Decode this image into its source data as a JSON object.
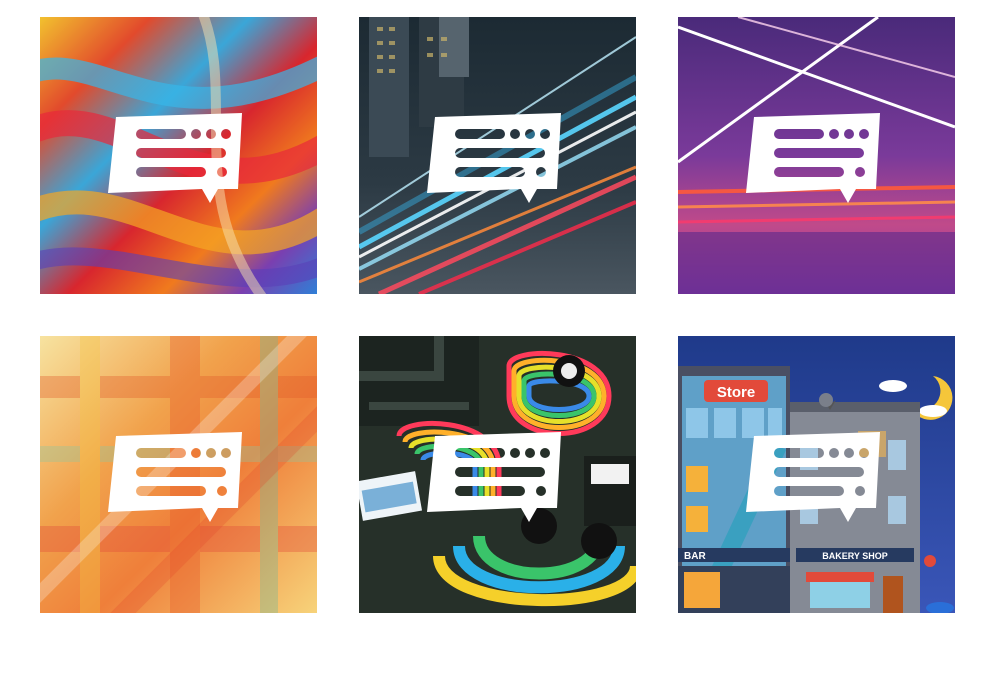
{
  "gallery": {
    "tiles": [
      {
        "theme": "abstract-swirl",
        "accent": "#e8503a"
      },
      {
        "theme": "light-trails-city",
        "accent": "#2a8fb8"
      },
      {
        "theme": "neon-purple-trails",
        "accent": "#c02c7a"
      },
      {
        "theme": "plaid-gradient",
        "accent": "#ef8a2c"
      },
      {
        "theme": "3d-rainbow-tubes",
        "accent": "#2f3a35"
      },
      {
        "theme": "illustrated-street",
        "accent": "#2e3c8a"
      }
    ],
    "street": {
      "store_sign": "Store",
      "bar_sign": "BAR",
      "bakery_sign": "BAKERY SHOP"
    }
  }
}
